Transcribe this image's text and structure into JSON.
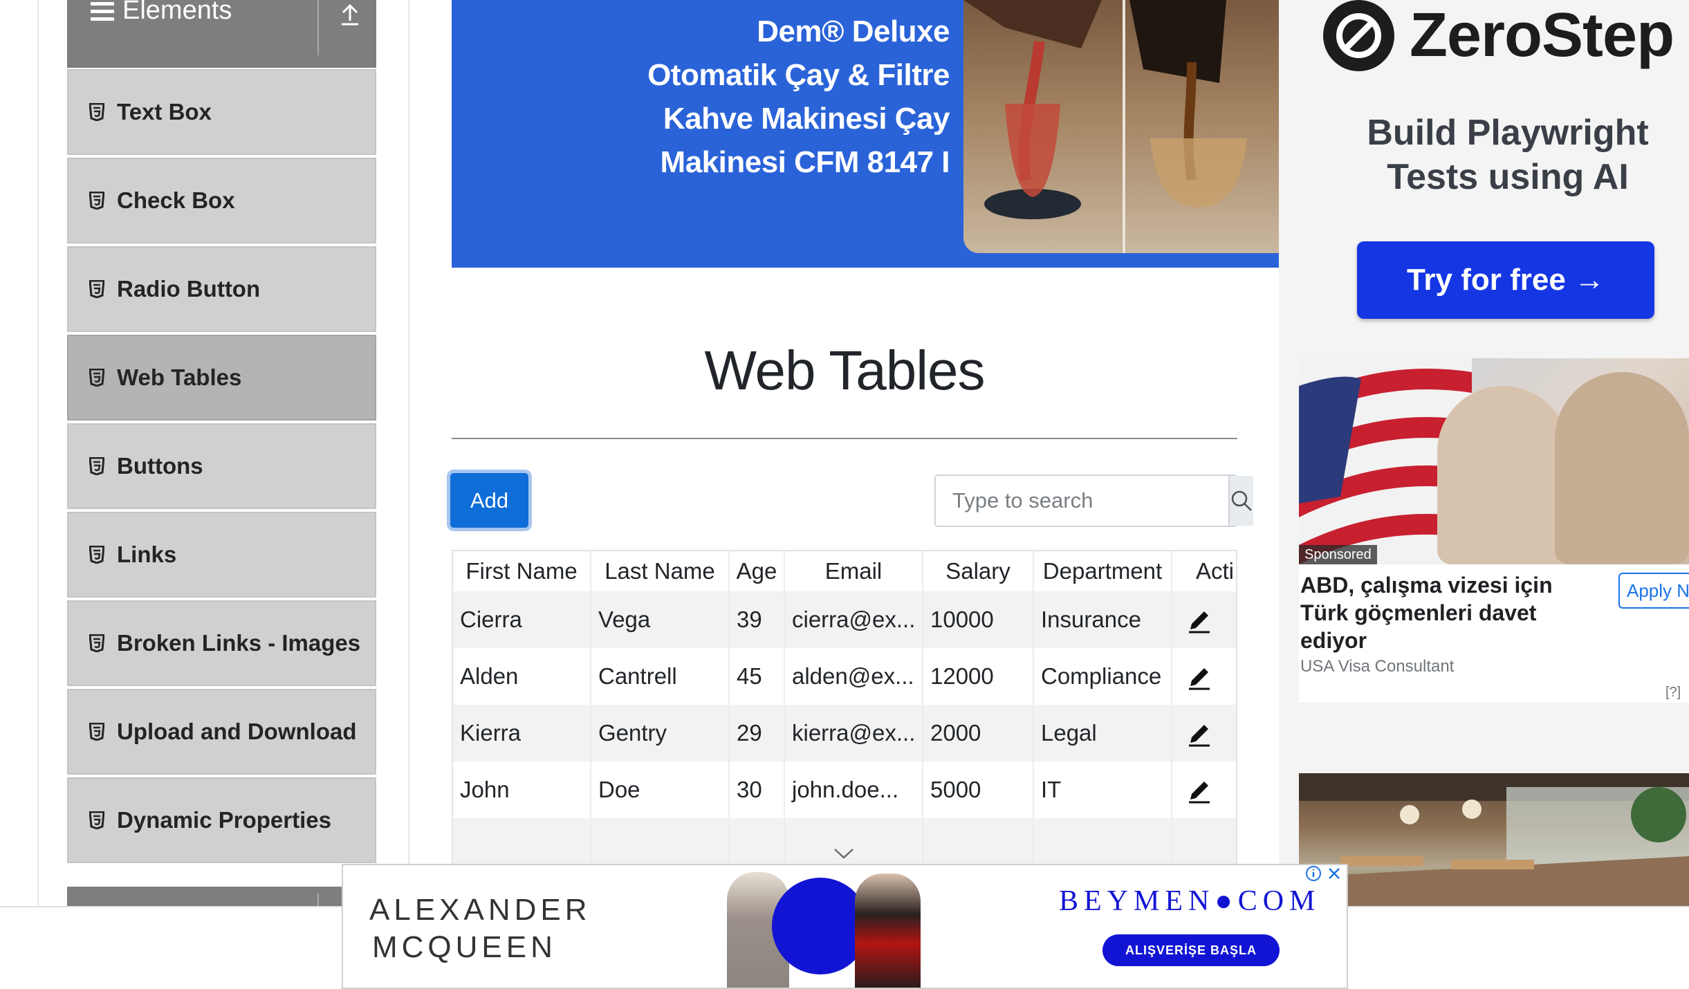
{
  "sidebar": {
    "group_title": "Elements",
    "items": [
      {
        "label": "Text Box",
        "active": false
      },
      {
        "label": "Check Box",
        "active": false
      },
      {
        "label": "Radio Button",
        "active": false
      },
      {
        "label": "Web Tables",
        "active": true
      },
      {
        "label": "Buttons",
        "active": false
      },
      {
        "label": "Links",
        "active": false
      },
      {
        "label": "Broken Links - Images",
        "active": false
      },
      {
        "label": "Upload and Download",
        "active": false
      },
      {
        "label": "Dynamic Properties",
        "active": false
      }
    ]
  },
  "top_banner": {
    "lines": [
      "Dem® Deluxe",
      "Otomatik Çay & Filtre",
      "Kahve Makinesi Çay",
      "Makinesi CFM 8147 I"
    ]
  },
  "main": {
    "title": "Web Tables",
    "add_label": "Add",
    "search": {
      "placeholder": "Type to search",
      "value": ""
    },
    "table": {
      "headers": [
        "First Name",
        "Last Name",
        "Age",
        "Email",
        "Salary",
        "Department",
        "Acti"
      ],
      "rows": [
        [
          "Cierra",
          "Vega",
          "39",
          "cierra@ex...",
          "10000",
          "Insurance"
        ],
        [
          "Alden",
          "Cantrell",
          "45",
          "alden@ex...",
          "12000",
          "Compliance"
        ],
        [
          "Kierra",
          "Gentry",
          "29",
          "kierra@ex...",
          "2000",
          "Legal"
        ],
        [
          "John",
          "Doe",
          "30",
          "john.doe...",
          "5000",
          "IT"
        ]
      ]
    }
  },
  "right_ads": {
    "zerostep": {
      "brand": "ZeroStep",
      "headline_line1": "Build Playwright",
      "headline_line2": "Tests using AI",
      "cta": "Try for free →"
    },
    "visa": {
      "sponsored": "Sponsored",
      "title": "ABD, çalışma vizesi için Türk göçmenleri davet ediyor",
      "source": "USA Visa Consultant",
      "cta": "Apply No",
      "help": "[?]"
    }
  },
  "bottom_ad": {
    "brand_line1": "ALEXANDER",
    "brand_line2": "MCQUEEN",
    "store": "BEYMEN●COM",
    "cta": "ALIŞVERİŞE BAŞLA"
  },
  "colors": {
    "sidebar_header": "#7d7e80",
    "sidebar_item": "#d0d0d0",
    "sidebar_active": "#b4b4b4",
    "add_button": "#0f6dd8",
    "banner_blue": "#2a63d8",
    "zerostep_blue": "#1536e3",
    "beymen_blue": "#1214d4"
  }
}
